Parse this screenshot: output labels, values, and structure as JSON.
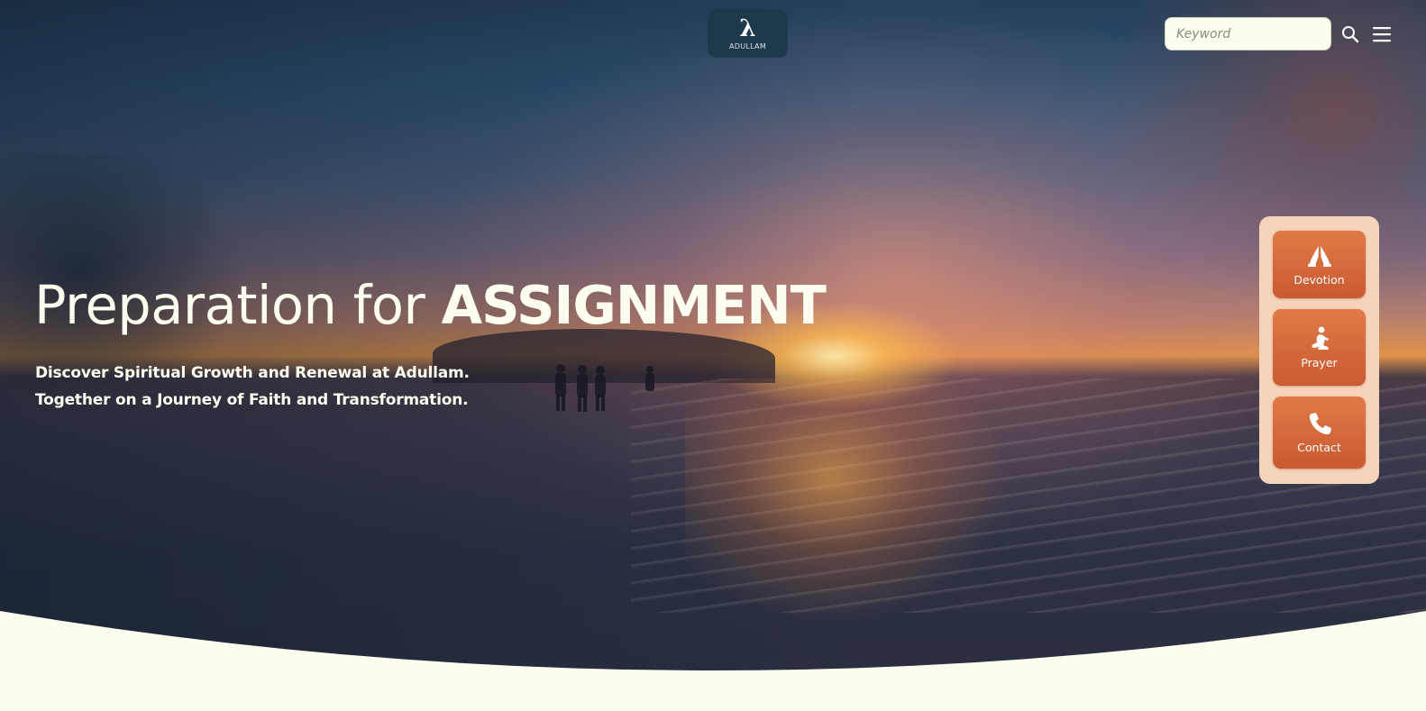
{
  "header": {
    "logo_mark": "λ",
    "logo_text": "ADULLAM",
    "search": {
      "placeholder": "Keyword",
      "value": ""
    },
    "icons": {
      "search": "search-icon",
      "menu": "hamburger-menu-icon"
    }
  },
  "hero": {
    "title_light": "Preparation for ",
    "title_bold": "ASSIGNMENT",
    "subtitle_lines": [
      "Discover Spiritual Growth and Renewal at Adullam.",
      "Together on a Journey of Faith and Transformation."
    ]
  },
  "quick_links": [
    {
      "label": "Devotion",
      "icon": "praying-hands-icon"
    },
    {
      "label": "Prayer",
      "icon": "kneeling-person-icon"
    },
    {
      "label": "Contact",
      "icon": "phone-icon"
    }
  ],
  "colors": {
    "cream": "#fdfdf0",
    "logo_bg": "#1c3a4c",
    "panel_bg": "#f6d3bb",
    "accent": "#d66a3b"
  }
}
